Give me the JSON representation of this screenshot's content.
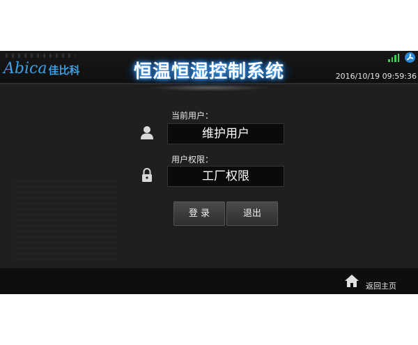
{
  "header": {
    "logo_latin": "Abica",
    "logo_cn": "佳比科",
    "title": "恒温恒湿控制系统",
    "datetime": "2016/10/19 09:59:36",
    "signal_color": "#3fd05a",
    "fan_color": "#2a88d8"
  },
  "login": {
    "current_user_label": "当前用户：",
    "current_user_value": "维护用户",
    "permission_label": "用户权限：",
    "permission_value": "工厂权限",
    "user_icon": "user-icon",
    "lock_icon": "lock-icon"
  },
  "buttons": {
    "login": "登 录",
    "exit": "退出"
  },
  "footer": {
    "home_label": "返回主页",
    "home_icon": "home-icon"
  },
  "colors": {
    "accent": "#3aa0e6",
    "background": "#1f1f1f"
  }
}
